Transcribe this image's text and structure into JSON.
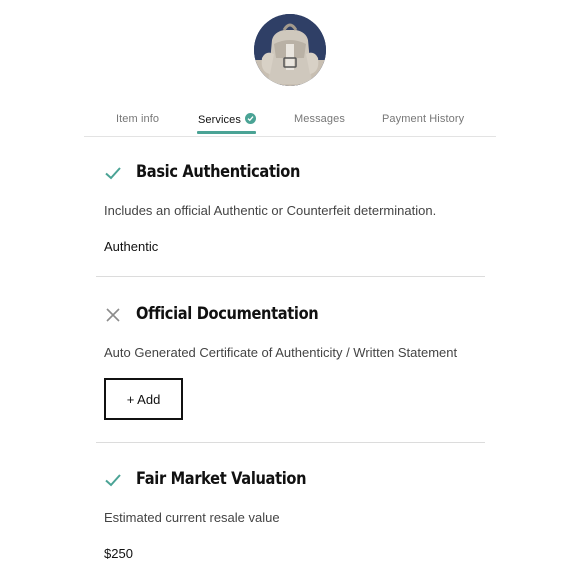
{
  "item": {
    "image_alt": "bag"
  },
  "tabs": [
    {
      "label": "Item info",
      "active": false
    },
    {
      "label": "Services",
      "active": true,
      "badge": "check-icon"
    },
    {
      "label": "Messages",
      "active": false
    },
    {
      "label": "Payment History",
      "active": false
    }
  ],
  "services": [
    {
      "status": "included",
      "icon": "check-icon",
      "title": "Basic Authentication",
      "description": "Includes an official Authentic or Counterfeit determination.",
      "value": "Authentic"
    },
    {
      "status": "not-included",
      "icon": "close-icon",
      "title": "Official Documentation",
      "description": "Auto Generated Certificate of Authenticity / Written Statement",
      "action_label": "+ Add"
    },
    {
      "status": "included",
      "icon": "check-icon",
      "title": "Fair Market Valuation",
      "description": "Estimated current resale value",
      "value": "$250"
    }
  ],
  "colors": {
    "accent": "#4aa395",
    "divider": "#dcdcdc",
    "close_icon": "#8c8c8c"
  }
}
